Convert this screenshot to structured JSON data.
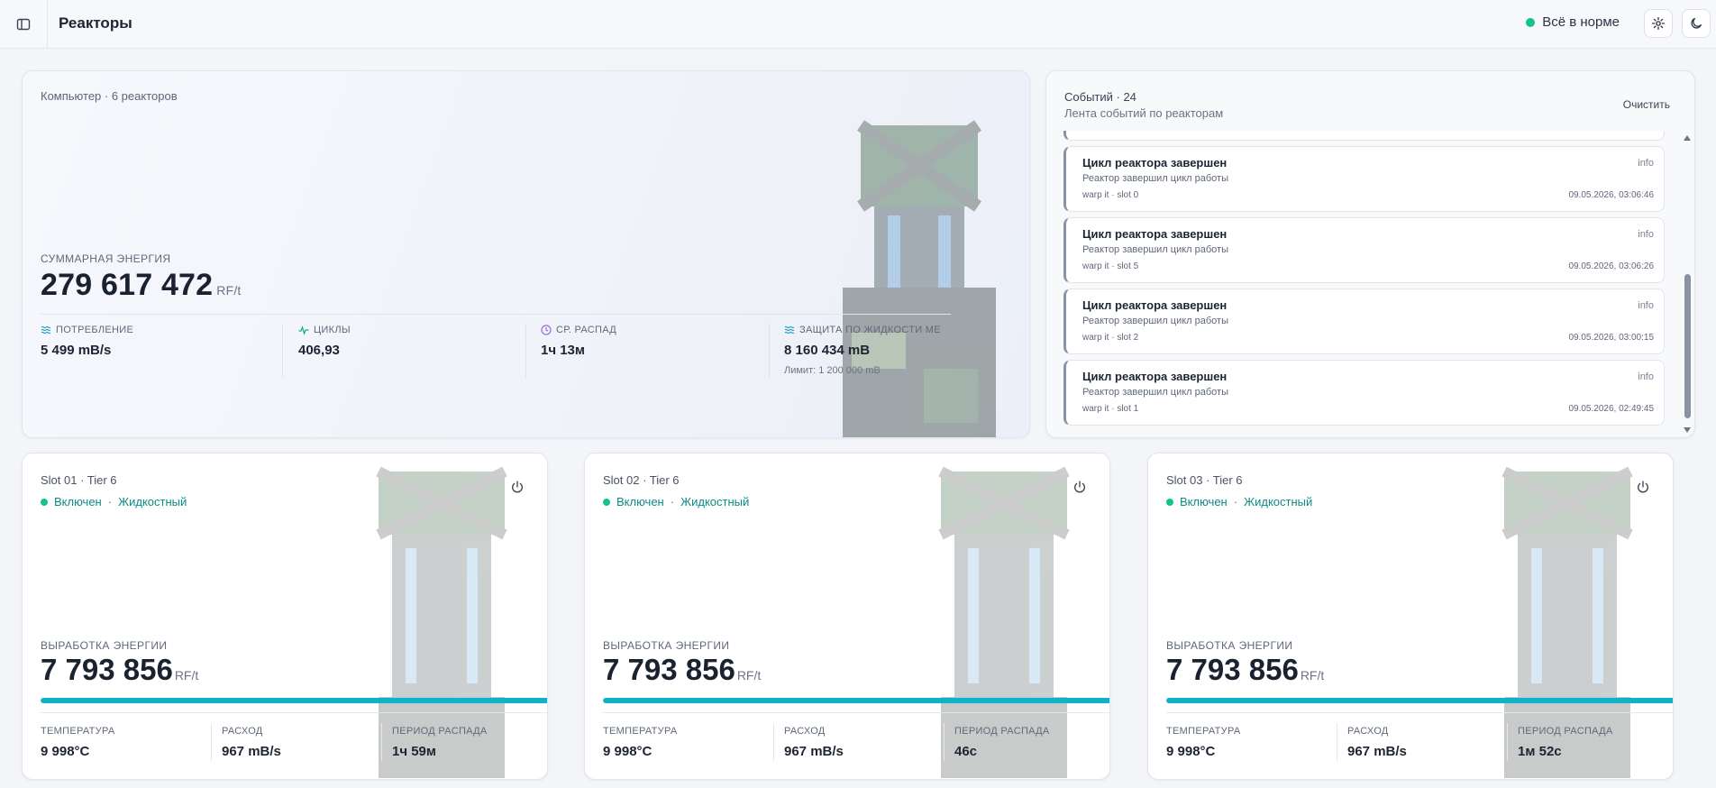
{
  "header": {
    "title": "Реакторы",
    "status": "Всё в норме",
    "status_color": "#10c48a"
  },
  "summary": {
    "subtitle": "Компьютер · 6 реакторов",
    "energy_label": "СУММАРНАЯ ЭНЕРГИЯ",
    "energy_value": "279 617 472",
    "energy_unit": "RF/t",
    "metrics": [
      {
        "icon": "waves-icon",
        "label": "ПОТРЕБЛЕНИЕ",
        "value": "5 499 mB/s"
      },
      {
        "icon": "pulse-icon",
        "label": "ЦИКЛЫ",
        "value": "406,93"
      },
      {
        "icon": "clock-icon",
        "label": "СР. РАСПАД",
        "value": "1ч 13м"
      },
      {
        "icon": "waves-icon",
        "label": "ЗАЩИТА ПО ЖИДКОСТИ МЕ",
        "value": "8 160 434 mB",
        "sub": "Лимит: 1 200 000 mB"
      }
    ]
  },
  "events": {
    "title": "Событий · 24",
    "subtitle": "Лента событий по реакторам",
    "clear_label": "Очистить",
    "items": [
      {
        "title": "Цикл реактора завершен",
        "level": "info",
        "desc": "Реактор завершил цикл работы",
        "source": "warp it · slot 0",
        "time": "09.05.2026, 03:06:46"
      },
      {
        "title": "Цикл реактора завершен",
        "level": "info",
        "desc": "Реактор завершил цикл работы",
        "source": "warp it · slot 5",
        "time": "09.05.2026, 03:06:26"
      },
      {
        "title": "Цикл реактора завершен",
        "level": "info",
        "desc": "Реактор завершил цикл работы",
        "source": "warp it · slot 2",
        "time": "09.05.2026, 03:00:15"
      },
      {
        "title": "Цикл реактора завершен",
        "level": "info",
        "desc": "Реактор завершил цикл работы",
        "source": "warp it · slot 1",
        "time": "09.05.2026, 02:49:45"
      }
    ]
  },
  "reactors": [
    {
      "title": "Slot 01 · Tier 6",
      "state": "Включен",
      "mode": "Жидкостный",
      "output_label": "ВЫРАБОТКА ЭНЕРГИИ",
      "output": "7 793 856",
      "unit": "RF/t",
      "load_fraction": 1.0,
      "temp_label": "ТЕМПЕРАТУРА",
      "temp": "9 998°C",
      "flow_label": "РАСХОД",
      "flow": "967 mB/s",
      "decay_label": "ПЕРИОД РАСПАДА",
      "decay": "1ч 59м"
    },
    {
      "title": "Slot 02 · Tier 6",
      "state": "Включен",
      "mode": "Жидкостный",
      "output_label": "ВЫРАБОТКА ЭНЕРГИИ",
      "output": "7 793 856",
      "unit": "RF/t",
      "load_fraction": 1.0,
      "temp_label": "ТЕМПЕРАТУРА",
      "temp": "9 998°C",
      "flow_label": "РАСХОД",
      "flow": "967 mB/s",
      "decay_label": "ПЕРИОД РАСПАДА",
      "decay": "46с"
    },
    {
      "title": "Slot 03 · Tier 6",
      "state": "Включен",
      "mode": "Жидкостный",
      "output_label": "ВЫРАБОТКА ЭНЕРГИИ",
      "output": "7 793 856",
      "unit": "RF/t",
      "load_fraction": 1.0,
      "temp_label": "ТЕМПЕРАТУРА",
      "temp": "9 998°C",
      "flow_label": "РАСХОД",
      "flow": "967 mB/s",
      "decay_label": "ПЕРИОД РАСПАДА",
      "decay": "1м 52с"
    }
  ],
  "colors": {
    "accent": "#0fb3c9",
    "online": "#10c48a",
    "mode_text": "#0e8a86"
  }
}
